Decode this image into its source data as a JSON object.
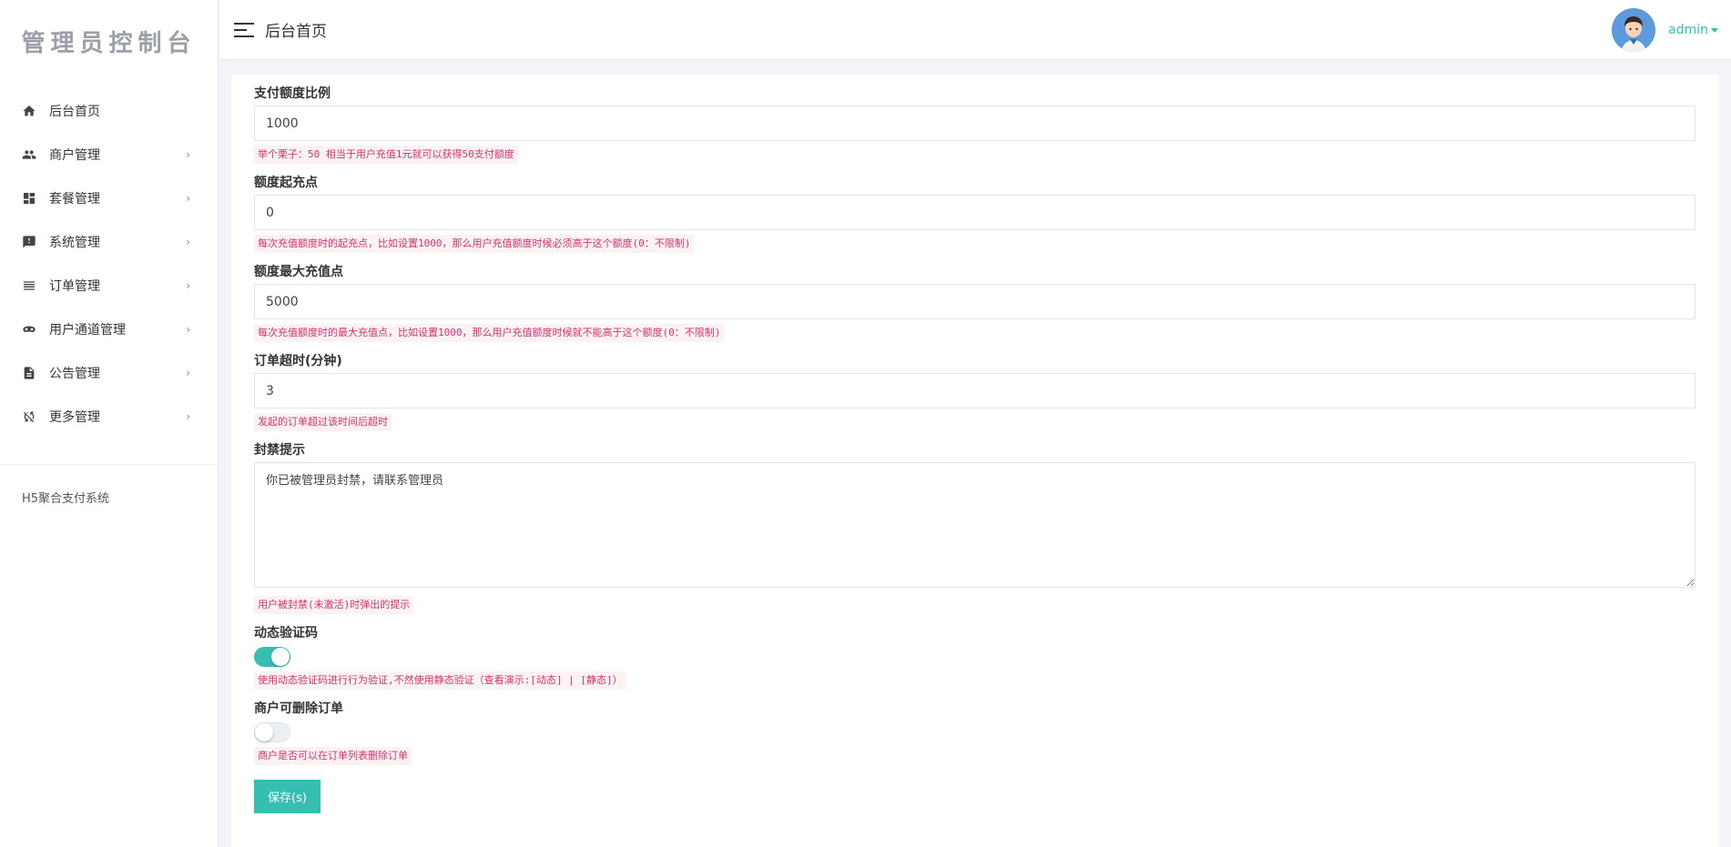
{
  "sidebar": {
    "logo": "管理员控制台",
    "items": [
      {
        "label": "后台首页",
        "icon": "home-icon",
        "has_children": false
      },
      {
        "label": "商户管理",
        "icon": "people-icon",
        "has_children": true
      },
      {
        "label": "套餐管理",
        "icon": "dashboard-icon",
        "has_children": true
      },
      {
        "label": "系统管理",
        "icon": "feedback-icon",
        "has_children": true
      },
      {
        "label": "订单管理",
        "icon": "list-icon",
        "has_children": true
      },
      {
        "label": "用户通道管理",
        "icon": "mask-icon",
        "has_children": true
      },
      {
        "label": "公告管理",
        "icon": "document-icon",
        "has_children": true
      },
      {
        "label": "更多管理",
        "icon": "sync-disabled-icon",
        "has_children": true
      }
    ],
    "chevron": "›",
    "footer": "H5聚合支付系统"
  },
  "header": {
    "title": "后台首页",
    "username": "admin"
  },
  "form": {
    "pay_ratio": {
      "label": "支付额度比例",
      "value": "1000",
      "hint": "举个栗子：50 相当于用户充值1元就可以获得50支付额度"
    },
    "min_recharge": {
      "label": "额度起充点",
      "value": "0",
      "hint": "每次充值额度时的起充点，比如设置1000，那么用户充值额度时候必须高于这个额度(0：不限制)"
    },
    "max_recharge": {
      "label": "额度最大充值点",
      "value": "5000",
      "hint": "每次充值额度时的最大充值点，比如设置1000，那么用户充值额度时候就不能高于这个额度(0：不限制)"
    },
    "order_timeout": {
      "label": "订单超时(分钟)",
      "value": "3",
      "hint": "发起的订单超过该时间后超时"
    },
    "ban_notice": {
      "label": "封禁提示",
      "value": "你已被管理员封禁，请联系管理员",
      "hint": "用户被封禁(未激活)时弹出的提示"
    },
    "dynamic_captcha": {
      "label": "动态验证码",
      "enabled": true,
      "hint": "使用动态验证码进行行为验证,不然使用静态验证（查看演示:[动态] | [静态]）"
    },
    "merchant_delete": {
      "label": "商户可删除订单",
      "enabled": false,
      "hint": "商户是否可以在订单列表删除订单"
    },
    "save_label": "保存(s)"
  },
  "colors": {
    "accent": "#36bfb1",
    "hint_text": "#d6336c",
    "hint_bg": "#fbf2f4"
  }
}
